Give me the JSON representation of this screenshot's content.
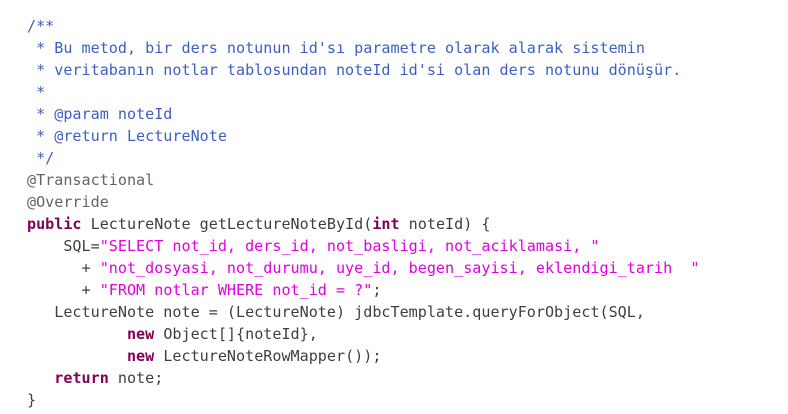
{
  "editor": {
    "lines": [
      [
        {
          "type": "comment",
          "text": "/**"
        }
      ],
      [
        {
          "type": "comment",
          "text": " * Bu metod, bir ders notunun id'sı parametre olarak alarak sistemin"
        }
      ],
      [
        {
          "type": "comment",
          "text": " * veritabanın notlar tablosundan noteId id'si olan ders notunu dönüşür."
        }
      ],
      [
        {
          "type": "comment",
          "text": " *"
        }
      ],
      [
        {
          "type": "comment",
          "text": " * @param noteId"
        }
      ],
      [
        {
          "type": "comment",
          "text": " * @return LectureNote"
        }
      ],
      [
        {
          "type": "comment",
          "text": " */"
        }
      ],
      [
        {
          "type": "annotation",
          "text": "@Transactional"
        }
      ],
      [
        {
          "type": "annotation",
          "text": "@Override"
        }
      ],
      [
        {
          "type": "keyword",
          "text": "public"
        },
        {
          "type": "plain",
          "text": " LectureNote getLectureNoteById("
        },
        {
          "type": "keyword",
          "text": "int"
        },
        {
          "type": "plain",
          "text": " noteId) {"
        }
      ],
      [
        {
          "type": "plain",
          "text": "    SQL="
        },
        {
          "type": "string",
          "text": "\"SELECT not_id, ders_id, not_basligi, not_aciklamasi, \""
        }
      ],
      [
        {
          "type": "plain",
          "text": "      + "
        },
        {
          "type": "string",
          "text": "\"not_dosyasi, not_durumu, uye_id, begen_sayisi, eklendigi_tarih  \""
        }
      ],
      [
        {
          "type": "plain",
          "text": "      + "
        },
        {
          "type": "string",
          "text": "\"FROM notlar WHERE not_id = ?\""
        },
        {
          "type": "plain",
          "text": ";"
        }
      ],
      [
        {
          "type": "plain",
          "text": "   LectureNote note = (LectureNote) jdbcTemplate.queryForObject(SQL,"
        }
      ],
      [
        {
          "type": "plain",
          "text": "           "
        },
        {
          "type": "keyword",
          "text": "new"
        },
        {
          "type": "plain",
          "text": " Object[]{noteId},"
        }
      ],
      [
        {
          "type": "plain",
          "text": "           "
        },
        {
          "type": "keyword",
          "text": "new"
        },
        {
          "type": "plain",
          "text": " LectureNoteRowMapper());"
        }
      ],
      [
        {
          "type": "plain",
          "text": "   "
        },
        {
          "type": "keyword",
          "text": "return"
        },
        {
          "type": "plain",
          "text": " note;"
        }
      ],
      [
        {
          "type": "plain",
          "text": "}"
        }
      ]
    ]
  },
  "colors": {
    "comment": "#3f5fbf",
    "annotation": "#646464",
    "keyword": "#7f0055",
    "string": "#e000e0",
    "plain": "#3f3f3f",
    "background": "#ffffff"
  }
}
